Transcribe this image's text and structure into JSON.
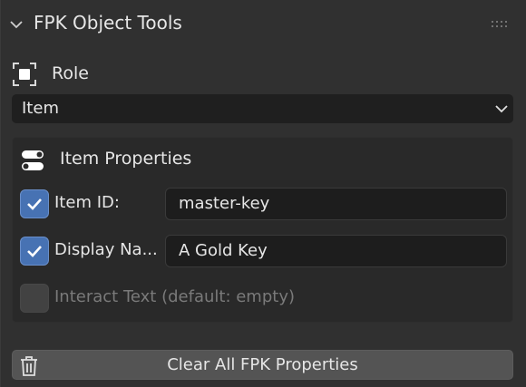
{
  "panel": {
    "title": "FPK Object Tools"
  },
  "role": {
    "label": "Role",
    "selected": "Item"
  },
  "item_properties": {
    "title": "Item Properties",
    "rows": [
      {
        "label": "Item ID:",
        "checked": true,
        "value": "master-key"
      },
      {
        "label": "Display Na...",
        "checked": true,
        "value": "A Gold Key"
      },
      {
        "label": "Interact Text  (default: empty)",
        "checked": false
      }
    ]
  },
  "actions": {
    "clear_label": "Clear All FPK Properties"
  },
  "colors": {
    "background": "#303030",
    "checkbox_on": "#4772b3",
    "field_bg": "#1d1d1d",
    "button_bg": "#545454"
  }
}
